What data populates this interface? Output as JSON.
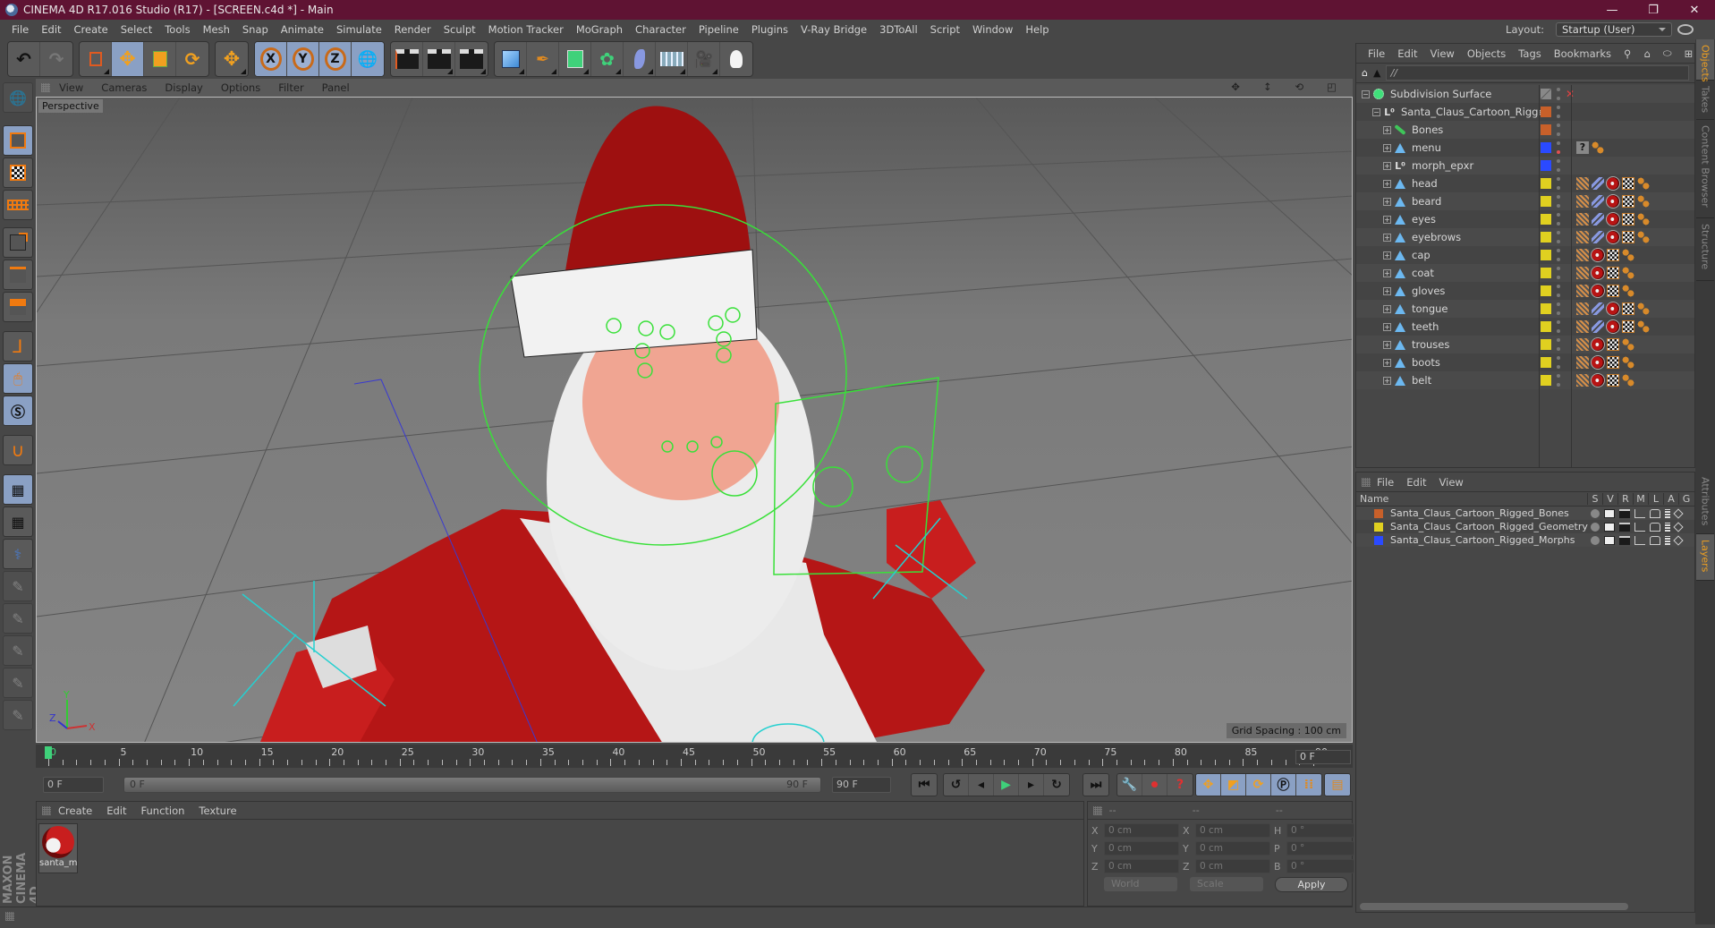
{
  "window": {
    "title": "CINEMA 4D R17.016 Studio (R17) - [SCREEN.c4d *] - Main",
    "controls": [
      "minimize",
      "restore",
      "close"
    ]
  },
  "menubar": {
    "items": [
      "File",
      "Edit",
      "Create",
      "Select",
      "Tools",
      "Mesh",
      "Snap",
      "Animate",
      "Simulate",
      "Render",
      "Sculpt",
      "Motion Tracker",
      "MoGraph",
      "Character",
      "Pipeline",
      "Plugins",
      "V-Ray Bridge",
      "3DToAll",
      "Script",
      "Window",
      "Help"
    ],
    "layout_label": "Layout:",
    "layout_value": "Startup (User)"
  },
  "toolbar": {
    "groups": [
      [
        "undo-icon",
        "redo-icon"
      ],
      [
        "live-selection-icon",
        "move-icon",
        "scale-icon",
        "rotate-icon"
      ],
      [
        "recent-tools-icon"
      ],
      [
        "x-axis-lock-icon",
        "y-axis-lock-icon",
        "z-axis-lock-icon",
        "world-coordinate-system-icon"
      ],
      [
        "render-view-icon",
        "render-picture-viewer-icon",
        "render-settings-icon"
      ],
      [
        "cube-icon",
        "pen-spline-icon",
        "subdivision-surface-icon",
        "array-icon",
        "deformer-icon",
        "floor-icon",
        "camera-icon",
        "light-icon"
      ]
    ],
    "axis_labels": [
      "X",
      "Y",
      "Z"
    ]
  },
  "left_tools": [
    "make-editable-icon",
    "model-mode-icon",
    "texture-mode-icon",
    "workplane-mode-icon",
    "points-mode-icon",
    "edges-mode-icon",
    "polygons-mode-icon",
    "axis-mode-icon",
    "tweak-mode-icon",
    "solo-icon",
    "snap-icon",
    "workplane-lock-icon",
    "workplane-align-icon",
    "python-icon",
    "sculpt-brush-icon",
    "sculpt-pull-icon",
    "sculpt-smooth-icon",
    "sculpt-inflate-icon",
    "sculpt-flatten-icon"
  ],
  "viewport": {
    "menu": [
      "View",
      "Cameras",
      "Display",
      "Options",
      "Filter",
      "Panel"
    ],
    "camera_label": "Perspective",
    "grid_spacing": "Grid Spacing : 100 cm",
    "axis_labels": {
      "x": "X",
      "y": "Y",
      "z": "Z"
    }
  },
  "timeline": {
    "ruler_labels": [
      "0",
      "5",
      "10",
      "15",
      "20",
      "25",
      "30",
      "35",
      "40",
      "45",
      "50",
      "55",
      "60",
      "65",
      "70",
      "75",
      "80",
      "85",
      "90"
    ],
    "current_frame": "0 F",
    "start_field": "0 F",
    "slider_start": "0 F",
    "slider_end": "90 F",
    "end_field": "90 F",
    "current_frame_field": "0 F"
  },
  "materials": {
    "menu": [
      "Create",
      "Edit",
      "Function",
      "Texture"
    ],
    "items": [
      {
        "name": "santa_m"
      }
    ]
  },
  "brand": {
    "line1": "MAXON",
    "line2": "CINEMA 4D"
  },
  "coordinates": {
    "headers": [
      "--",
      "--",
      "--"
    ],
    "rows": [
      {
        "a_label": "X",
        "a": "0 cm",
        "b_label": "X",
        "b": "0 cm",
        "c_label": "H",
        "c": "0 °"
      },
      {
        "a_label": "Y",
        "a": "0 cm",
        "b_label": "Y",
        "b": "0 cm",
        "c_label": "P",
        "c": "0 °"
      },
      {
        "a_label": "Z",
        "a": "0 cm",
        "b_label": "Z",
        "b": "0 cm",
        "c_label": "B",
        "c": "0 °"
      }
    ],
    "mode_dropdown": "World",
    "size_dropdown": "Scale",
    "apply_label": "Apply"
  },
  "objects_panel": {
    "menu": [
      "File",
      "Edit",
      "View",
      "Objects",
      "Tags",
      "Bookmarks"
    ],
    "path": "//",
    "tree": [
      {
        "name": "Subdivision Surface",
        "icon": "subdivision-icon",
        "depth": 0,
        "layer": null,
        "tags": []
      },
      {
        "name": "Santa_Claus_Cartoon_Rigged",
        "icon": "null-icon",
        "depth": 1,
        "layer": "#c8602a",
        "tags": []
      },
      {
        "name": "Bones",
        "icon": "bone-icon",
        "depth": 2,
        "layer": "#c8602a",
        "tags": []
      },
      {
        "name": "menu",
        "icon": "polygon-icon",
        "depth": 2,
        "layer": "#2a4aff",
        "tags": [
          "unknown-tag",
          "pose-morph-tag"
        ],
        "red_dot": true
      },
      {
        "name": "morph_epxr",
        "icon": "null-icon",
        "depth": 2,
        "layer": "#2a4aff",
        "tags": []
      },
      {
        "name": "head",
        "icon": "polygon-icon",
        "depth": 2,
        "layer": "#e0d020",
        "tags": [
          "weight-tag",
          "ik-tag",
          "material-tag",
          "uvw-tag",
          "pose-morph-tag"
        ]
      },
      {
        "name": "beard",
        "icon": "polygon-icon",
        "depth": 2,
        "layer": "#e0d020",
        "tags": [
          "weight-tag",
          "ik-tag",
          "material-tag",
          "uvw-tag",
          "pose-morph-tag"
        ]
      },
      {
        "name": "eyes",
        "icon": "polygon-icon",
        "depth": 2,
        "layer": "#e0d020",
        "tags": [
          "weight-tag",
          "ik-tag",
          "material-tag",
          "uvw-tag",
          "pose-morph-tag"
        ]
      },
      {
        "name": "eyebrows",
        "icon": "polygon-icon",
        "depth": 2,
        "layer": "#e0d020",
        "tags": [
          "weight-tag",
          "ik-tag",
          "material-tag",
          "uvw-tag",
          "pose-morph-tag"
        ]
      },
      {
        "name": "cap",
        "icon": "polygon-icon",
        "depth": 2,
        "layer": "#e0d020",
        "tags": [
          "weight-tag",
          "material-tag",
          "uvw-tag",
          "pose-morph-tag"
        ]
      },
      {
        "name": "coat",
        "icon": "polygon-icon",
        "depth": 2,
        "layer": "#e0d020",
        "tags": [
          "weight-tag",
          "material-tag",
          "uvw-tag",
          "pose-morph-tag"
        ]
      },
      {
        "name": "gloves",
        "icon": "polygon-icon",
        "depth": 2,
        "layer": "#e0d020",
        "tags": [
          "weight-tag",
          "material-tag",
          "uvw-tag",
          "pose-morph-tag"
        ]
      },
      {
        "name": "tongue",
        "icon": "polygon-icon",
        "depth": 2,
        "layer": "#e0d020",
        "tags": [
          "weight-tag",
          "ik-tag",
          "material-tag",
          "uvw-tag",
          "pose-morph-tag"
        ]
      },
      {
        "name": "teeth",
        "icon": "polygon-icon",
        "depth": 2,
        "layer": "#e0d020",
        "tags": [
          "weight-tag",
          "ik-tag",
          "material-tag",
          "uvw-tag",
          "pose-morph-tag"
        ]
      },
      {
        "name": "trouses",
        "icon": "polygon-icon",
        "depth": 2,
        "layer": "#e0d020",
        "tags": [
          "weight-tag",
          "material-tag",
          "uvw-tag",
          "pose-morph-tag"
        ]
      },
      {
        "name": "boots",
        "icon": "polygon-icon",
        "depth": 2,
        "layer": "#e0d020",
        "tags": [
          "weight-tag",
          "material-tag",
          "uvw-tag",
          "pose-morph-tag"
        ]
      },
      {
        "name": "belt",
        "icon": "polygon-icon",
        "depth": 2,
        "layer": "#e0d020",
        "tags": [
          "weight-tag",
          "material-tag",
          "uvw-tag",
          "pose-morph-tag"
        ]
      }
    ]
  },
  "layers_panel": {
    "menu": [
      "File",
      "Edit",
      "View"
    ],
    "name_header": "Name",
    "columns": [
      "S",
      "V",
      "R",
      "M",
      "L",
      "A",
      "G"
    ],
    "layers": [
      {
        "name": "Santa_Claus_Cartoon_Rigged_Bones",
        "color": "#c8602a"
      },
      {
        "name": "Santa_Claus_Cartoon_Rigged_Geometry",
        "color": "#e0d020"
      },
      {
        "name": "Santa_Claus_Cartoon_Rigged_Morphs",
        "color": "#2a4aff"
      }
    ]
  },
  "side_tabs": {
    "top": [
      {
        "label": "Objects",
        "active": true
      },
      {
        "label": "Takes",
        "active": false
      },
      {
        "label": "Content Browser",
        "active": false
      },
      {
        "label": "Structure",
        "active": false
      }
    ],
    "bottom": [
      {
        "label": "Attributes",
        "active": false
      },
      {
        "label": "Layers",
        "active": true
      }
    ]
  },
  "colors": {
    "accent": "#8aa0c4",
    "titlebar": "#5f1333",
    "active_tab": "#f0a020",
    "timeline_cursor": "#3fd17a"
  }
}
